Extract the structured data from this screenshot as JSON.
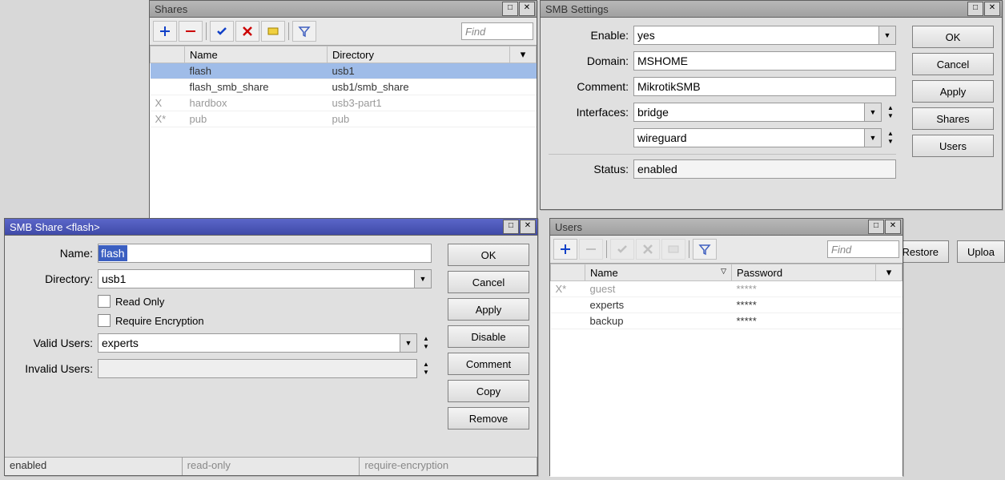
{
  "bg": {
    "restore": "Restore",
    "upload": "Uploa"
  },
  "shares": {
    "title": "Shares",
    "cols": {
      "name": "Name",
      "dir": "Directory"
    },
    "find": "Find",
    "rows": [
      {
        "flag": "",
        "name": "flash",
        "dir": "usb1",
        "sel": true
      },
      {
        "flag": "",
        "name": "flash_smb_share",
        "dir": "usb1/smb_share"
      },
      {
        "flag": "X",
        "name": "hardbox",
        "dir": "usb3-part1",
        "disabled": true
      },
      {
        "flag": "X*",
        "name": "pub",
        "dir": "pub",
        "disabled": true
      }
    ]
  },
  "smb": {
    "title": "SMB Settings",
    "labels": {
      "enable": "Enable:",
      "domain": "Domain:",
      "comment": "Comment:",
      "interfaces": "Interfaces:",
      "status": "Status:"
    },
    "values": {
      "enable": "yes",
      "domain": "MSHOME",
      "comment": "MikrotikSMB",
      "if1": "bridge",
      "if2": "wireguard",
      "status": "enabled"
    },
    "buttons": {
      "ok": "OK",
      "cancel": "Cancel",
      "apply": "Apply",
      "shares": "Shares",
      "users": "Users"
    }
  },
  "share": {
    "title": "SMB Share <flash>",
    "labels": {
      "name": "Name:",
      "dir": "Directory:",
      "readonly": "Read Only",
      "reqenc": "Require Encryption",
      "valid": "Valid Users:",
      "invalid": "Invalid Users:"
    },
    "values": {
      "name": "flash",
      "dir": "usb1",
      "valid": "experts",
      "invalid": ""
    },
    "buttons": {
      "ok": "OK",
      "cancel": "Cancel",
      "apply": "Apply",
      "disable": "Disable",
      "comment": "Comment",
      "copy": "Copy",
      "remove": "Remove"
    },
    "status": {
      "enabled": "enabled",
      "ro": "read-only",
      "enc": "require-encryption"
    }
  },
  "users": {
    "title": "Users",
    "cols": {
      "name": "Name",
      "pass": "Password"
    },
    "find": "Find",
    "rows": [
      {
        "flag": "X*",
        "name": "guest",
        "pass": "*****",
        "disabled": true
      },
      {
        "flag": "",
        "name": "experts",
        "pass": "*****"
      },
      {
        "flag": "",
        "name": "backup",
        "pass": "*****"
      }
    ]
  }
}
